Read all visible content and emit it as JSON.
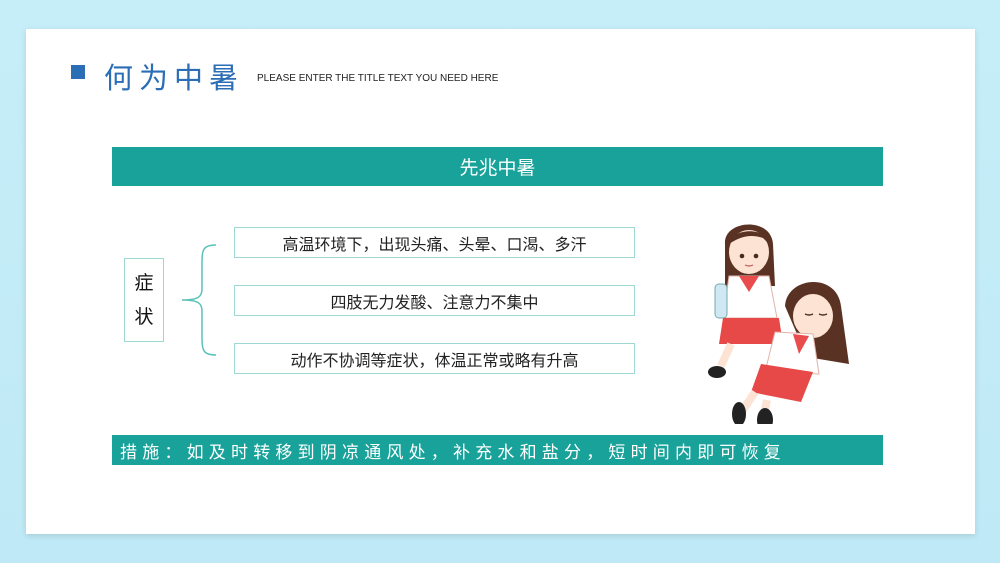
{
  "header": {
    "title": "何为中暑",
    "subtitle": "PLEASE ENTER THE TITLE TEXT YOU NEED HERE"
  },
  "banner": {
    "label": "先兆中暑"
  },
  "symptom": {
    "label_line1": "症",
    "label_line2": "状",
    "items": [
      "高温环境下，出现头痛、头晕、口渴、多汗",
      "四肢无力发酸、注意力不集中",
      "动作不协调等症状，体温正常或略有升高"
    ]
  },
  "measures": {
    "text": "措施：如及时转移到阴凉通风处，补充水和盐分，短时间内即可恢复"
  },
  "colors": {
    "teal": "#18a29a",
    "title_blue": "#2b6eb5",
    "border": "#9fd8d2"
  },
  "icons": {
    "title_marker": "square-marker-icon",
    "illustration": "two-schoolgirls-illustration"
  }
}
